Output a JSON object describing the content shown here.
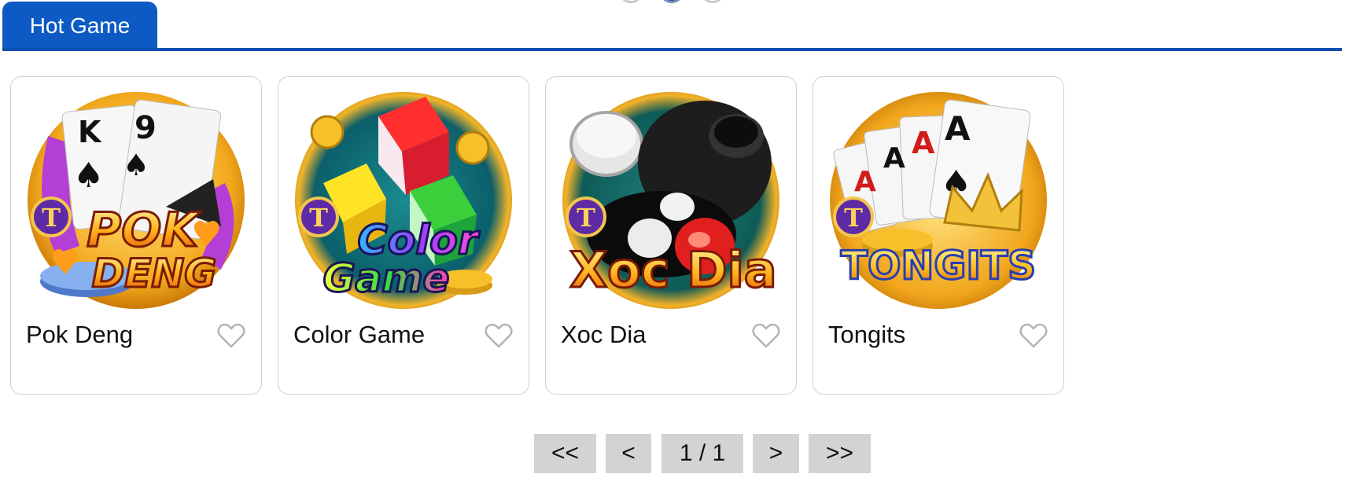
{
  "section": {
    "tab_label": "Hot Game"
  },
  "carousel": {
    "dot_count": 3,
    "active_index": 1
  },
  "colors": {
    "accent": "#0d5ac4",
    "card_border": "#d0d0d0",
    "pager_bg": "#d3d3d3"
  },
  "games": [
    {
      "title": "Pok Deng",
      "art_text_1": "POK",
      "art_text_2": "DENG",
      "badge": "T",
      "icon": "pok-deng-thumbnail"
    },
    {
      "title": "Color Game",
      "art_text_1": "Color",
      "art_text_2": "Game",
      "badge": "T",
      "icon": "color-game-thumbnail"
    },
    {
      "title": "Xoc Dia",
      "art_text_1": "Xoc Dia",
      "art_text_2": "",
      "badge": "T",
      "icon": "xoc-dia-thumbnail"
    },
    {
      "title": "Tongits",
      "art_text_1": "TONGITS",
      "art_text_2": "",
      "badge": "T",
      "icon": "tongits-thumbnail"
    }
  ],
  "pagination": {
    "first_label": "<<",
    "prev_label": "<",
    "page_label": "1 / 1",
    "next_label": ">",
    "last_label": ">>"
  }
}
